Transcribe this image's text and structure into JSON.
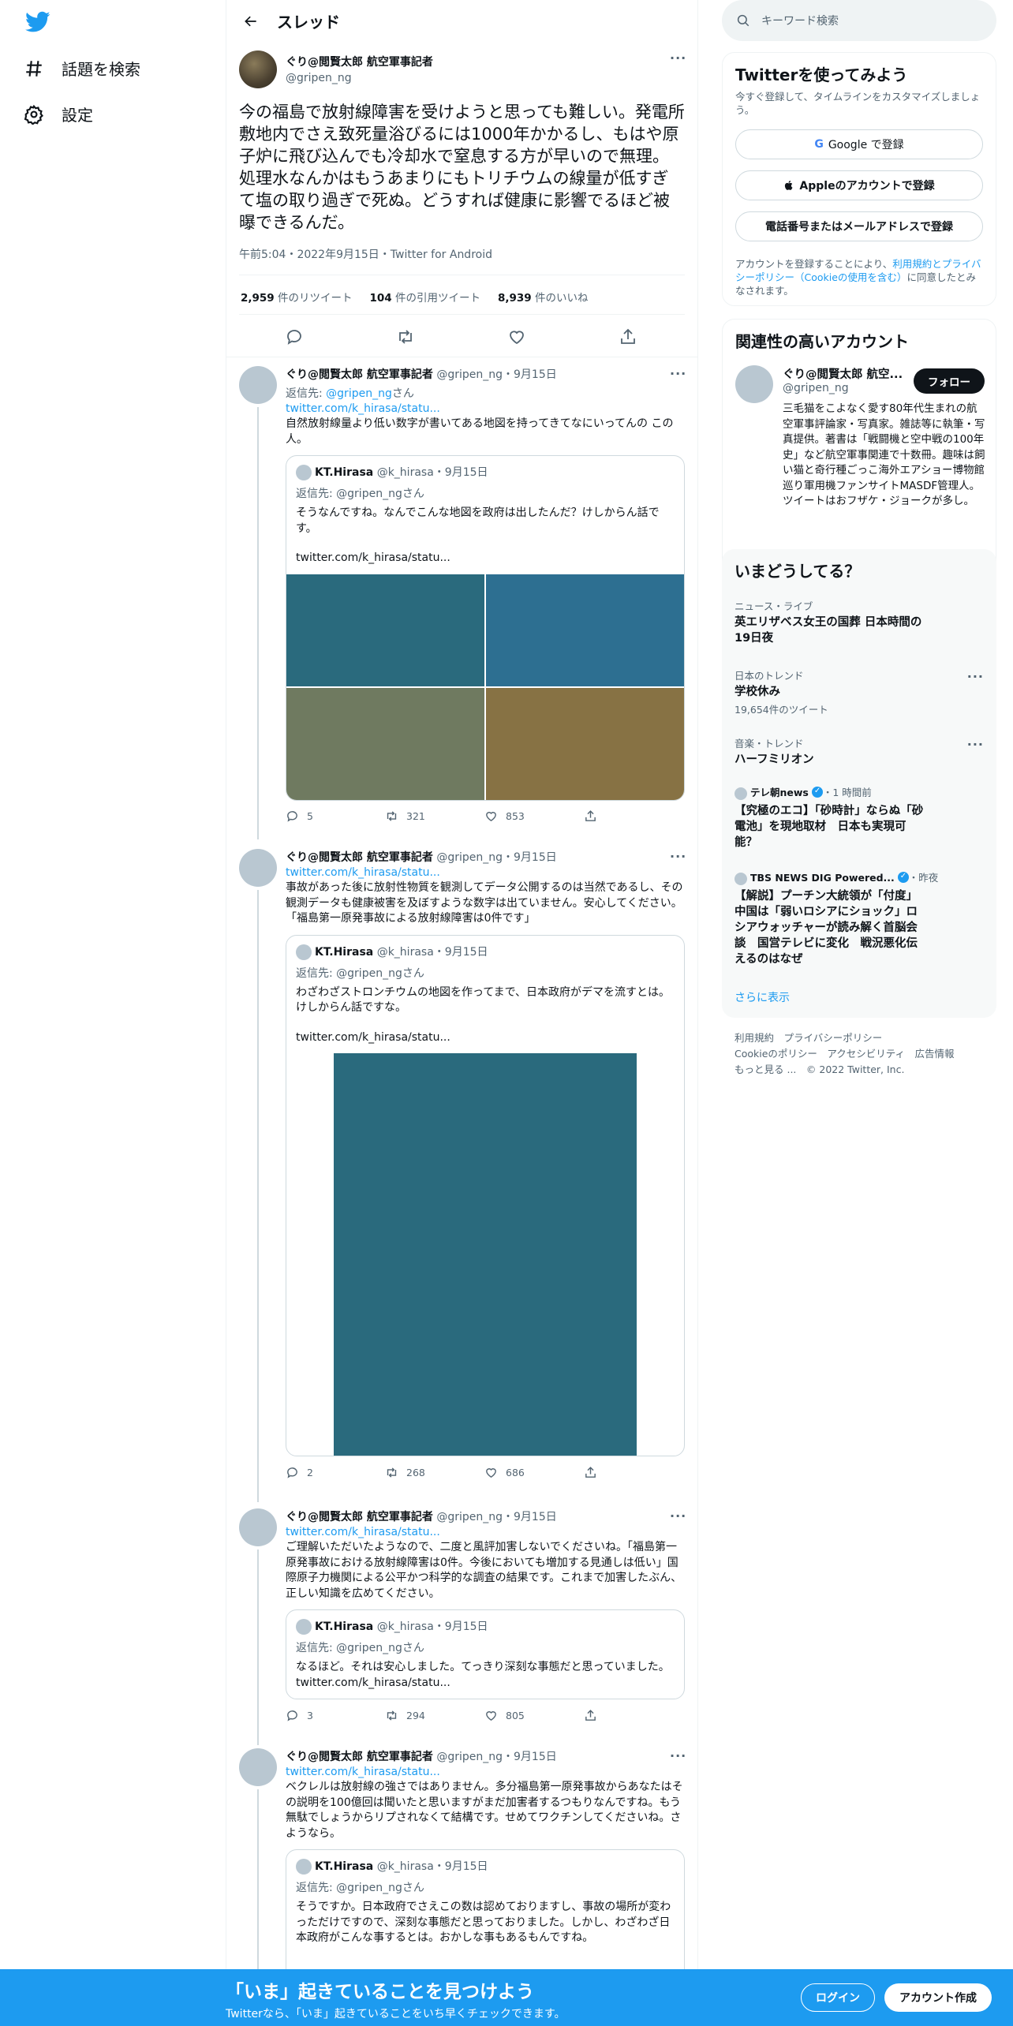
{
  "nav": {
    "explore_label": "話題を検索",
    "settings_label": "設定"
  },
  "header": {
    "title": "スレッド"
  },
  "main_tweet": {
    "display_name": "ぐり@閲賢太郎 航空軍事記者",
    "handle": "@gripen_ng",
    "text": "今の福島で放射線障害を受けようと思っても難しい。発電所敷地内でさえ致死量浴びるには1000年かかるし、もはや原子炉に飛び込んでも冷却水で窒息する方が早いので無理。処理水なんかはもうあまりにもトリチウムの線量が低すぎて塩の取り過ぎで死ぬ。どうすれば健康に影響でるほど被曝できるんだ。",
    "meta": "午前5:04・2022年9月15日・Twitter for Android",
    "retweets_count": "2,959",
    "retweets_label": " 件のリツイート",
    "quotes_count": "104",
    "quotes_label": " 件の引用ツイート",
    "likes_count": "8,939",
    "likes_label": " 件のいいね"
  },
  "replies": [
    {
      "name": "ぐり@閲賢太郎 航空軍事記者",
      "handle": "@gripen_ng",
      "date": "・9月15日",
      "reply_to_prefix": "返信先: ",
      "reply_to_handle": "@gripen_ng",
      "reply_to_suffix": "さん",
      "link": "twitter.com/k_hirasa/statu...",
      "text": "自然放射線量より低い数字が書いてある地図を持ってきてなにいってんの この人。",
      "quote": {
        "name": "KT.Hirasa",
        "handle": "@k_hirasa",
        "date": "・9月15日",
        "reply_to": "返信先: @gripen_ngさん",
        "text": "そうなんですね。なんでこんな地図を政府は出したんだ？けしからん話です。",
        "link": "twitter.com/k_hirasa/statu..."
      },
      "replies_count": "5",
      "retweets_count": "321",
      "likes_count": "853"
    },
    {
      "name": "ぐり@閲賢太郎 航空軍事記者",
      "handle": "@gripen_ng",
      "date": "・9月15日",
      "link": "twitter.com/k_hirasa/statu...",
      "text": "事故があった後に放射性物質を観測してデータ公開するのは当然であるし、その観測データも健康被害を及ぼすような数字は出ていません。安心してください。「福島第一原発事故による放射線障害は0件です」",
      "quote": {
        "name": "KT.Hirasa",
        "handle": "@k_hirasa",
        "date": "・9月15日",
        "reply_to": "返信先: @gripen_ngさん",
        "text": "わざわざストロンチウムの地図を作ってまで、日本政府がデマを流すとは。けしからん話ですな。",
        "link": "twitter.com/k_hirasa/statu..."
      },
      "replies_count": "2",
      "retweets_count": "268",
      "likes_count": "686"
    },
    {
      "name": "ぐり@閲賢太郎 航空軍事記者",
      "handle": "@gripen_ng",
      "date": "・9月15日",
      "link": "twitter.com/k_hirasa/statu...",
      "text": "ご理解いただいたようなので、二度と風評加害しないでくださいね。「福島第一原発事故における放射線障害は0件。今後においても増加する見通しは低い」国際原子力機関による公平かつ科学的な調査の結果です。これまで加害したぶん、正しい知識を広めてください。",
      "quote": {
        "name": "KT.Hirasa",
        "handle": "@k_hirasa",
        "date": "・9月15日",
        "reply_to": "返信先: @gripen_ngさん",
        "text": "なるほど。それは安心しました。てっきり深刻な事態だと思っていました。",
        "link": "twitter.com/k_hirasa/statu..."
      },
      "replies_count": "3",
      "retweets_count": "294",
      "likes_count": "805"
    },
    {
      "name": "ぐり@閲賢太郎 航空軍事記者",
      "handle": "@gripen_ng",
      "date": "・9月15日",
      "link": "twitter.com/k_hirasa/statu...",
      "text": "ベクレルは放射線の強さではありません。多分福島第一原発事故からあなたはその説明を100億回は聞いたと思いますがまだ加害者するつもりなんですね。もう無駄でしょうからリプされなくて結構です。せめてワクチンしてくださいね。さようなら。",
      "quote": {
        "name": "KT.Hirasa",
        "handle": "@k_hirasa",
        "date": "・9月15日",
        "reply_to": "返信先: @gripen_ngさん",
        "text": "そうですか。日本政府でさえこの数は認めておりますし、事故の場所が変わっただけですので、深刻な事態だと思っておりました。しかし、わざわざ日本政府がこんな事するとは。おかしな事もあるもんですね。"
      }
    }
  ],
  "search": {
    "placeholder": "キーワード検索"
  },
  "signup_panel": {
    "title": "Twitterを使ってみよう",
    "subtitle": "今すぐ登録して、タイムラインをカスタマイズしましょう。",
    "google_label": "Google で登録",
    "apple_label": "Appleのアカウントで登録",
    "phone_label": "電話番号またはメールアドレスで登録",
    "terms_prefix": "アカウントを登録することにより、",
    "terms_link": "利用規約とプライバシーポリシー（Cookieの使用を含む）",
    "terms_suffix": "に同意したとみなされます。"
  },
  "related_panel": {
    "title": "関連性の高いアカウント",
    "name": "ぐり@閲賢太郎 航空...",
    "handle": "@gripen_ng",
    "follow_label": "フォロー",
    "bio": "三毛猫をこよなく愛す80年代生まれの航空軍事評論家・写真家。雑誌等に執筆・写真提供。著書は「戦闘機と空中戦の100年史」など航空軍事関連で十数冊。趣味は飼い猫と奇行種ごっこ海外エアショー博物館巡り軍用機ファンサイトMASDF管理人。ツイートはおフザケ・ジョークが多し。"
  },
  "trends_panel": {
    "title": "いまどうしてる？",
    "items": [
      {
        "context": "ニュース・ライブ",
        "title": "英エリザベス女王の国葬 日本時間の19日夜"
      },
      {
        "context": "日本のトレンド",
        "title": "学校休み",
        "count": "19,654件のツイート"
      },
      {
        "context": "音楽・トレンド",
        "title": "ハーフミリオン"
      },
      {
        "source": "テレ朝news",
        "time": "・1 時間前",
        "title": "【究極のエコ】「砂時計」ならぬ「砂電池」を現地取材　日本も実現可能？"
      },
      {
        "source": "TBS NEWS DIG Powered...",
        "time": "・昨夜",
        "title": "【解説】プーチン大統領が「付度」中国は「弱いロシアにショック」ロシアウォッチャーが読み解く首脳会談　国営テレビに変化　戦況悪化伝えるのはなぜ"
      }
    ],
    "show_more": "さらに表示"
  },
  "footer": {
    "line1": "利用規約　プライバシーポリシー",
    "line2": "Cookieのポリシー　アクセシビリティ　広告情報",
    "line3": "もっと見る ...　© 2022 Twitter, Inc."
  },
  "bottom_bar": {
    "title": "「いま」起きていることを見つけよう",
    "subtitle": "Twitterなら、「いま」起きていることをいち早くチェックできます。",
    "login_label": "ログイン",
    "signup_label": "アカウント作成"
  },
  "colors": {
    "accent": "#1d9bf0",
    "map_teal": "#2a6a7d",
    "map_blue": "#2d6f91",
    "map_grey_green": "#6f7a60",
    "map_olive": "#877244"
  }
}
